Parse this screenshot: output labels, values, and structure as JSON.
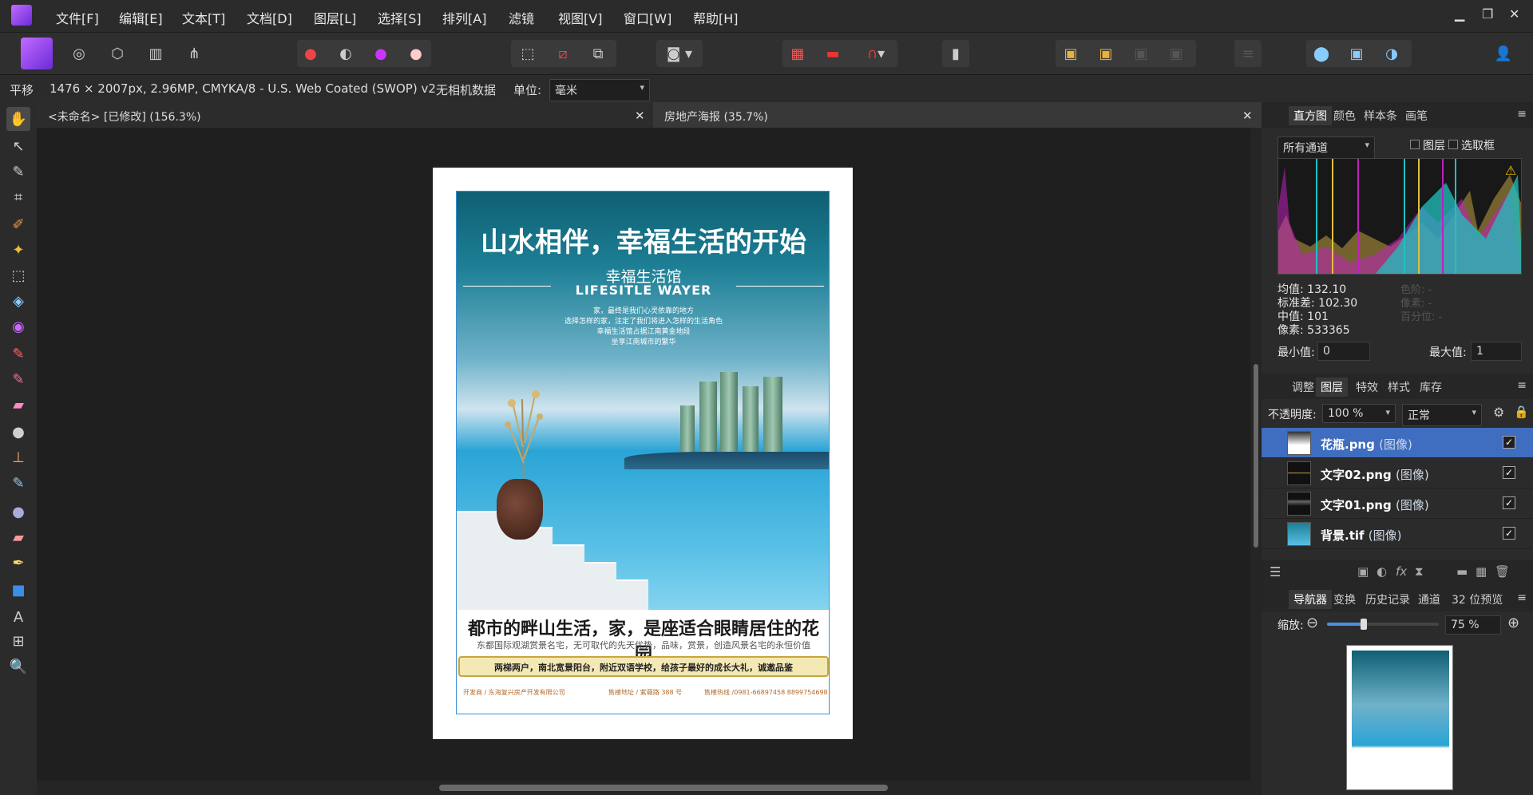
{
  "menu": [
    "文件[F]",
    "编辑[E]",
    "文本[T]",
    "文档[D]",
    "图层[L]",
    "选择[S]",
    "排列[A]",
    "滤镜",
    "视图[V]",
    "窗口[W]",
    "帮助[H]"
  ],
  "context": {
    "tool_name": "平移",
    "doc_info": "1476 × 2007px, 2.96MP, CMYKA/8 - U.S. Web Coated (SWOP) v2",
    "camera_data": "无相机数据",
    "unit_label": "单位:",
    "unit_value": "毫米"
  },
  "tabs": {
    "tab1": "<未命名> [已修改] (156.3%)",
    "tab2": "房地产海报 (35.7%)",
    "close": "✕"
  },
  "poster": {
    "title": "山水相伴，幸福生活的开始",
    "brand_cn": "幸福生活馆",
    "brand_en": "LIFESITLE WAYER",
    "intro1": "家，最终是我们心灵依靠的地方",
    "intro2": "选择怎样的家，注定了我们将进入怎样的生活角色",
    "intro3": "幸福生活馆占据江南黄金地段",
    "intro4": "坐享江南城市的繁华",
    "headline": "都市的畔山生活，家，是座适合眼睛居住的花园",
    "subline": "东都国际观湖赏景名宅，无可取代的先天优势，品味，赏景，创造风景名宅的永恒价值",
    "banner": "两梯两户，南北宽景阳台，附近双语学校，给孩子最好的成长大礼，诚邀品鉴",
    "foot1": "开发商 / 东海复兴房产开发有限公司",
    "foot2": "售楼地址 / 紫薇路 388 号",
    "foot3": "售楼热线 /0981-66897458 8899754698"
  },
  "panel_top": {
    "tabs": [
      "直方图",
      "颜色",
      "样本条",
      "画笔"
    ],
    "channel": "所有通道",
    "layer_chk": "图层",
    "marquee_chk": "选取框",
    "mean": "均值: 132.10",
    "std": "标准差: 102.30",
    "median": "中值: 101",
    "pixels": "像素: 533365",
    "dim_level": "色阶: -",
    "dim_count": "像素: -",
    "dim_pct": "百分位: -",
    "min_label": "最小值:",
    "min_value": "0",
    "max_label": "最大值:",
    "max_value": "1"
  },
  "panel_layers": {
    "tabs": [
      "调整",
      "图层",
      "特效",
      "样式",
      "库存"
    ],
    "opacity_label": "不透明度:",
    "opacity_value": "100 %",
    "blend_mode": "正常",
    "layers": [
      {
        "name": "花瓶.png",
        "type": "(图像)"
      },
      {
        "name": "文字02.png",
        "type": "(图像)"
      },
      {
        "name": "文字01.png",
        "type": "(图像)"
      },
      {
        "name": "背景.tif",
        "type": "(图像)"
      }
    ]
  },
  "panel_nav": {
    "tabs": [
      "导航器",
      "变换",
      "历史记录",
      "通道",
      "32 位预览"
    ],
    "zoom_label": "缩放:",
    "zoom_value": "75 %",
    "zoom_level": 0.33
  },
  "colors": {
    "selection": "#3f6dbf",
    "app_bg": "#232323",
    "brand": "#8a3cf0"
  }
}
